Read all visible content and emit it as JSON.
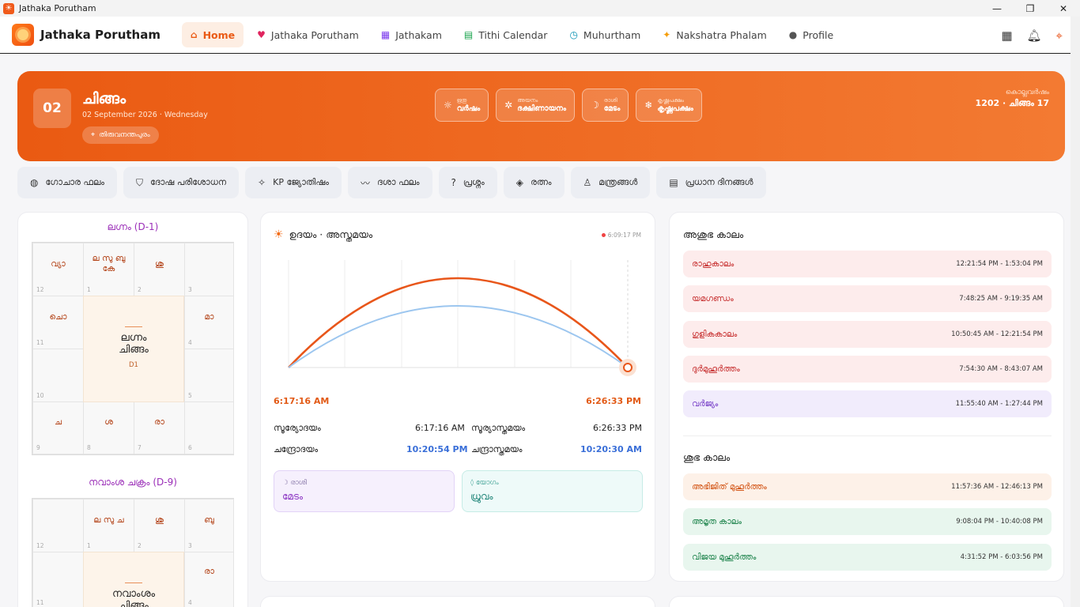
{
  "window": {
    "title": "Jathaka Porutham",
    "min": "—",
    "max": "❐",
    "close": "✕"
  },
  "nav": {
    "brand": "Jathaka Porutham",
    "links": [
      {
        "label": "Home",
        "icon": "home-icon",
        "glyph": "⌂"
      },
      {
        "label": "Jathaka Porutham",
        "icon": "heart-icon",
        "glyph": "♥"
      },
      {
        "label": "Jathakam",
        "icon": "grid-icon",
        "glyph": "▦"
      },
      {
        "label": "Tithi Calendar",
        "icon": "calendar-icon",
        "glyph": "▤"
      },
      {
        "label": "Muhurtham",
        "icon": "clock-icon",
        "glyph": "◷"
      },
      {
        "label": "Nakshatra Phalam",
        "icon": "sparkle-icon",
        "glyph": "✦"
      },
      {
        "label": "Profile",
        "icon": "person-icon",
        "glyph": "●"
      }
    ]
  },
  "hero": {
    "day": "02",
    "month": "ചിങ്ങം",
    "date_line": "02 September 2026 · Wednesday",
    "location": "തിരുവനന്തപുരം",
    "chips": [
      {
        "label": "ഋതു",
        "value": "വർഷം",
        "glyph": "☼"
      },
      {
        "label": "അയനം",
        "value": "ദക്ഷിണായനം",
        "glyph": "✲"
      },
      {
        "label": "രാശി",
        "value": "മേടം",
        "glyph": "☽"
      },
      {
        "label": "കൃഷ്ണപക്ഷം",
        "value": "കൃഷ്ണപക്ഷം",
        "glyph": "❄"
      }
    ],
    "kolla_label": "കൊല്ലവർഷം",
    "kolla_value": "1202 · ചിങ്ങം 17"
  },
  "features": [
    {
      "label": "ഗോചാര ഫലം",
      "glyph": "◍"
    },
    {
      "label": "ദോഷ പരിശോധന",
      "glyph": "⛉"
    },
    {
      "label": "KP ജ്യോതിഷം",
      "glyph": "✧"
    },
    {
      "label": "ദശാ ഫലം",
      "glyph": "〰"
    },
    {
      "label": "പ്രശ്നം",
      "glyph": "?"
    },
    {
      "label": "രത്നം",
      "glyph": "◈"
    },
    {
      "label": "മന്ത്രങ്ങൾ",
      "glyph": "♙"
    },
    {
      "label": "പ്രധാന ദിനങ്ങൾ",
      "glyph": "▤"
    }
  ],
  "rasi_chart": {
    "title": "ലഗ്നം (D-1)",
    "center_name": "ലഗ്നം",
    "center_rasi": "ചിങ്ങം",
    "center_code": "D1",
    "houses": [
      {
        "n": "12",
        "p": "വ്യാ"
      },
      {
        "n": "1",
        "p": "ല സു ബു കേ"
      },
      {
        "n": "2",
        "p": "ശു"
      },
      {
        "n": "3",
        "p": ""
      },
      {
        "n": "11",
        "p": "ചൊ"
      },
      {
        "n": "4",
        "p": "മാ"
      },
      {
        "n": "10",
        "p": ""
      },
      {
        "n": "5",
        "p": ""
      },
      {
        "n": "9",
        "p": "ച"
      },
      {
        "n": "8",
        "p": "ശ"
      },
      {
        "n": "7",
        "p": "രാ"
      },
      {
        "n": "6",
        "p": ""
      }
    ]
  },
  "navamsa_chart": {
    "title": "നവാംശ ചക്രം (D-9)",
    "center_name": "നവാംശം",
    "center_rasi": "ചിങ്ങം",
    "houses": [
      {
        "n": "12",
        "p": ""
      },
      {
        "n": "1",
        "p": "ല സു ച"
      },
      {
        "n": "2",
        "p": "ശു"
      },
      {
        "n": "3",
        "p": "ബു"
      },
      {
        "n": "11",
        "p": ""
      },
      {
        "n": "4",
        "p": "രാ"
      }
    ]
  },
  "sun": {
    "title": "ഉദയം · അസ്തമയം",
    "live_time": "6:09:17 PM",
    "sunrise_big": "6:17:16 AM",
    "sunset_big": "6:26:33 PM",
    "rows": [
      {
        "l1": "സൂര്യോദയം",
        "v1": "6:17:16 AM",
        "l2": "സൂര്യാസ്തമയം",
        "v2": "6:26:33 PM"
      },
      {
        "l1": "ചന്ദ്രോദയം",
        "v1": "10:20:54 PM",
        "l2": "ചന്ദ്രാസ്തമയം",
        "v2": "10:20:30 AM"
      }
    ],
    "rasi_label": "രാശി",
    "rasi_value": "മേടം",
    "yoga_label": "യോഗം",
    "yoga_value": "ധ്രുവം"
  },
  "ashubha": {
    "title": "അശുഭ കാലം",
    "items": [
      {
        "name": "രാഹുകാലം",
        "time": "12:21:54 PM - 1:53:04 PM",
        "kind": "bad"
      },
      {
        "name": "യമഗണ്ഡം",
        "time": "7:48:25 AM - 9:19:35 AM",
        "kind": "bad"
      },
      {
        "name": "ഗുളികകാലം",
        "time": "10:50:45 AM - 12:21:54 PM",
        "kind": "bad"
      },
      {
        "name": "ദുർമുഹൂർത്തം",
        "time": "7:54:30 AM - 8:43:07 AM",
        "kind": "bad"
      },
      {
        "name": "വർജ്യം",
        "time": "11:55:40 AM - 1:27:44 PM",
        "kind": "varj"
      }
    ]
  },
  "shubha": {
    "title": "ശുഭ കാലം",
    "items": [
      {
        "name": "അഭിജിത് മുഹൂർത്തം",
        "time": "11:57:36 AM - 12:46:13 PM",
        "kind": "abh"
      },
      {
        "name": "അമൃത കാലം",
        "time": "9:08:04 PM - 10:40:08 PM",
        "kind": "good"
      },
      {
        "name": "വിജയ മുഹൂർത്തം",
        "time": "4:31:52 PM - 6:03:56 PM",
        "kind": "good"
      }
    ]
  },
  "colors": {
    "accent": "#ea5a14",
    "sun_arc": "#e8561a",
    "moon_arc": "#9cc6ef"
  }
}
